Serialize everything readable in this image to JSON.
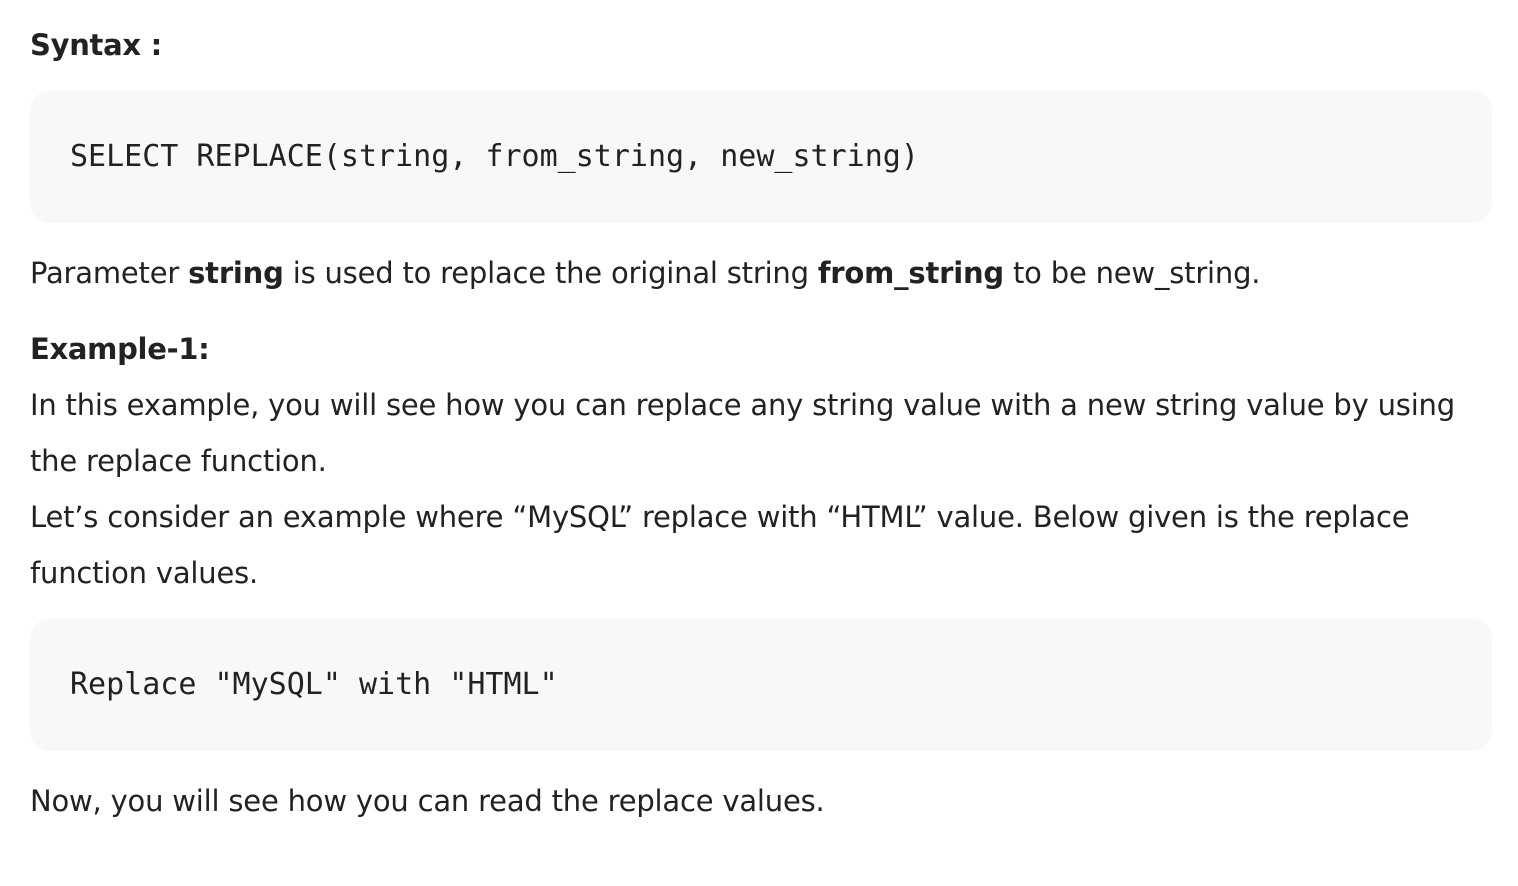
{
  "syntax_heading": "Syntax :",
  "syntax_code": "SELECT REPLACE(string, from_string, new_string)",
  "param_sentence": {
    "prefix": "Parameter ",
    "bold1": "string",
    "middle": " is used to replace the original string ",
    "bold2": "from_string",
    "suffix": " to be new_string."
  },
  "example_heading": "Example-1:",
  "example_para_1": "In this example, you will see how you can replace any string value with a new string value by using the replace function.",
  "example_para_2": "Let’s consider an example where “MySQL” replace with “HTML” value. Below given is the replace function values.",
  "example_code": "Replace \"MySQL\" with \"HTML\"",
  "closing_para": "Now, you will see how you can read the replace values."
}
